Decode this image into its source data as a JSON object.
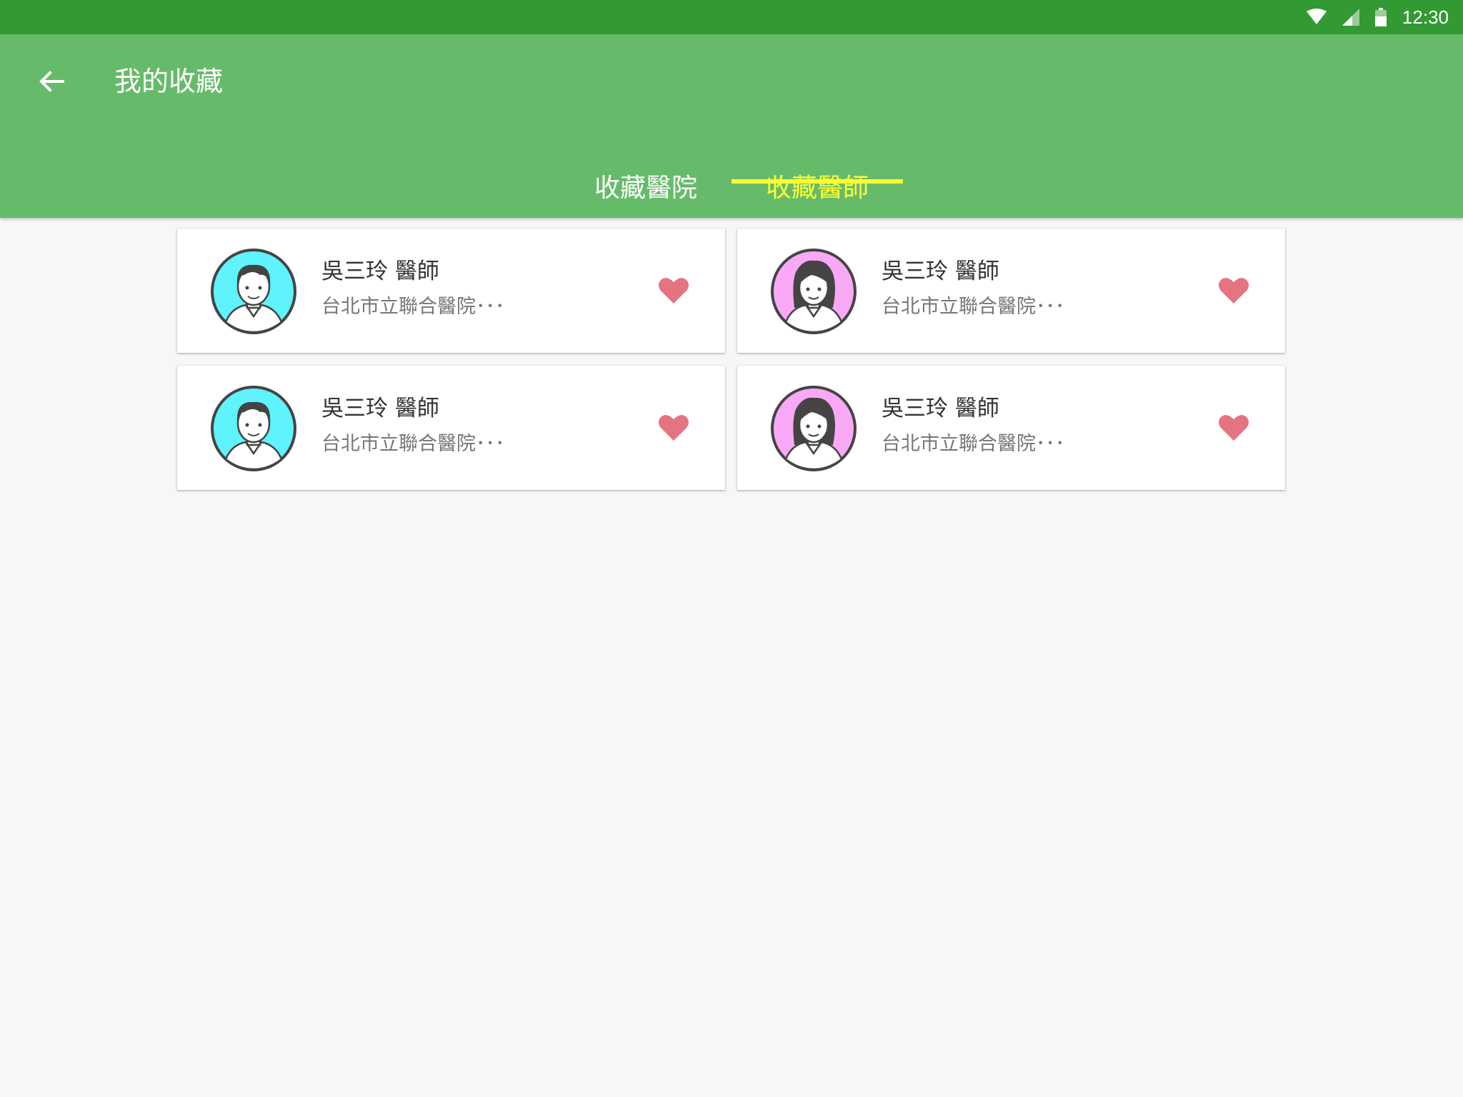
{
  "status_bar": {
    "time": "12:30"
  },
  "app_bar": {
    "title": "我的收藏"
  },
  "tabs": [
    {
      "label": "收藏醫院",
      "active": false
    },
    {
      "label": "收藏醫師",
      "active": true
    }
  ],
  "colors": {
    "status_bar": "#339933",
    "app_bar": "#66bb6a",
    "active_tab": "#ffff33",
    "heart": "#e57381",
    "male_avatar_bg": "#5ef3fd",
    "female_avatar_bg": "#f9a8f6"
  },
  "doctors": [
    {
      "name": "吳三玲 醫師",
      "hospital": "台北市立聯合醫院･･･",
      "avatar": "male-doctor-avatar",
      "favorited": true
    },
    {
      "name": "吳三玲 醫師",
      "hospital": "台北市立聯合醫院･･･",
      "avatar": "female-doctor-avatar",
      "favorited": true
    },
    {
      "name": "吳三玲 醫師",
      "hospital": "台北市立聯合醫院･･･",
      "avatar": "male-doctor-avatar",
      "favorited": true
    },
    {
      "name": "吳三玲 醫師",
      "hospital": "台北市立聯合醫院･･･",
      "avatar": "female-doctor-avatar",
      "favorited": true
    }
  ]
}
